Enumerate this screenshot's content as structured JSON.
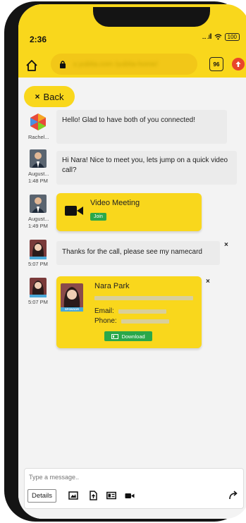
{
  "status": {
    "time": "2:36",
    "signal": "... .ıll",
    "battery": "100"
  },
  "browser": {
    "url": "x.yubita.com /yubita-home/",
    "tab_count": "96"
  },
  "nav": {
    "back_label": "Back"
  },
  "messages": [
    {
      "sender": "Rachel...",
      "time": "",
      "text": "Hello! Glad to have both of you connected!"
    },
    {
      "sender": "August...",
      "time": "1:48 PM",
      "text": "Hi Nara! Nice to meet you, lets jump on a quick video call?"
    },
    {
      "sender": "August...",
      "time": "1:49 PM",
      "meeting_title": "Video Meeting",
      "join_label": "Join"
    },
    {
      "sender": "",
      "time": "5:07 PM",
      "text": "Thanks for the call, please see my namecard"
    },
    {
      "sender": "",
      "time": "5:07 PM"
    }
  ],
  "namecard": {
    "name": "Nara Park",
    "sponsor_tag": "SPONSOR",
    "email_label": "Email:",
    "phone_label": "Phone:",
    "download_label": "Download"
  },
  "composer": {
    "placeholder": "Type a message..",
    "details_label": "Details"
  },
  "colors": {
    "accent": "#f9d71c",
    "button_green": "#2aa84a",
    "bubble": "#ebebeb",
    "background": "#f3f3f3"
  }
}
